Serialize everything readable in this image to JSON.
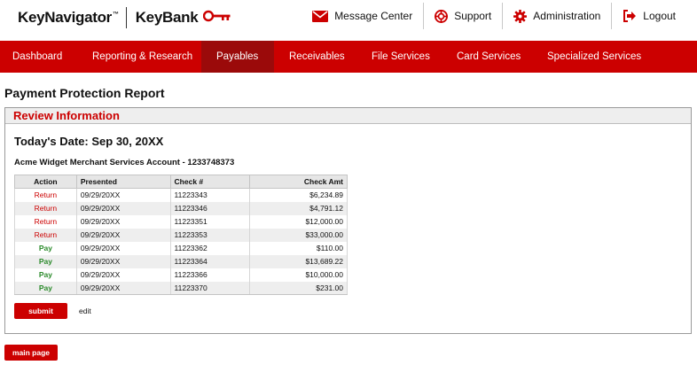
{
  "header": {
    "brand_primary": "KeyNavigator",
    "brand_tm": "™",
    "brand_secondary": "KeyBank",
    "links": [
      {
        "label": "Message Center",
        "icon": "envelope-icon"
      },
      {
        "label": "Support",
        "icon": "lifebuoy-icon"
      },
      {
        "label": "Administration",
        "icon": "gear-icon"
      },
      {
        "label": "Logout",
        "icon": "logout-icon"
      }
    ]
  },
  "colors": {
    "brand_red": "#cc0000",
    "active_tab": "#9b0a0a",
    "pay_green": "#2a8a2a"
  },
  "nav": {
    "items": [
      "Dashboard",
      "Reporting & Research",
      "Payables",
      "Receivables",
      "File Services",
      "Card Services",
      "Specialized Services"
    ],
    "active": "Payables"
  },
  "page": {
    "title": "Payment Protection Report",
    "panel_title": "Review Information",
    "todays_date": "Today's Date: Sep 30, 20XX",
    "account": "Acme Widget Merchant Services Account - 1233748373"
  },
  "table": {
    "headers": {
      "action": "Action",
      "presented": "Presented",
      "check": "Check #",
      "amount": "Check Amt"
    },
    "rows": [
      {
        "action": "Return",
        "presented": "09/29/20XX",
        "check": "11223343",
        "amount": "$6,234.89"
      },
      {
        "action": "Return",
        "presented": "09/29/20XX",
        "check": "11223346",
        "amount": "$4,791.12"
      },
      {
        "action": "Return",
        "presented": "09/29/20XX",
        "check": "11223351",
        "amount": "$12,000.00"
      },
      {
        "action": "Return",
        "presented": "09/29/20XX",
        "check": "11223353",
        "amount": "$33,000.00"
      },
      {
        "action": "Pay",
        "presented": "09/29/20XX",
        "check": "11223362",
        "amount": "$110.00"
      },
      {
        "action": "Pay",
        "presented": "09/29/20XX",
        "check": "11223364",
        "amount": "$13,689.22"
      },
      {
        "action": "Pay",
        "presented": "09/29/20XX",
        "check": "11223366",
        "amount": "$10,000.00"
      },
      {
        "action": "Pay",
        "presented": "09/29/20XX",
        "check": "11223370",
        "amount": "$231.00"
      }
    ]
  },
  "buttons": {
    "submit": "submit",
    "edit": "edit",
    "main_page": "main page"
  }
}
